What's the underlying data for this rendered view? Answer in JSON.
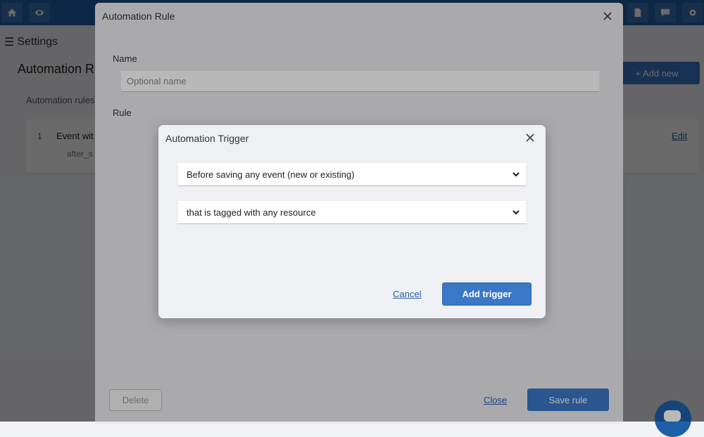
{
  "background": {
    "settings_label": "Settings",
    "page_title": "Automation R",
    "add_new_label": "+ Add new",
    "list_subtitle": "Automation rules",
    "rule_number": "1",
    "rule_name": "Event wit",
    "rule_sub": "after_s",
    "edit_label": "Edit"
  },
  "rule_modal": {
    "title": "Automation Rule",
    "name_label": "Name",
    "name_placeholder": "Optional name",
    "name_value": "",
    "rule_label": "Rule",
    "delete_label": "Delete",
    "close_label": "Close",
    "save_label": "Save rule"
  },
  "trigger_modal": {
    "title": "Automation Trigger",
    "event_select": "Before saving any event (new or existing)",
    "condition_select": "that is tagged with any resource",
    "cancel_label": "Cancel",
    "add_label": "Add trigger"
  },
  "colors": {
    "primary": "#3a78c7",
    "topbar": "#1f5fa8",
    "link": "#2a5fa8"
  }
}
